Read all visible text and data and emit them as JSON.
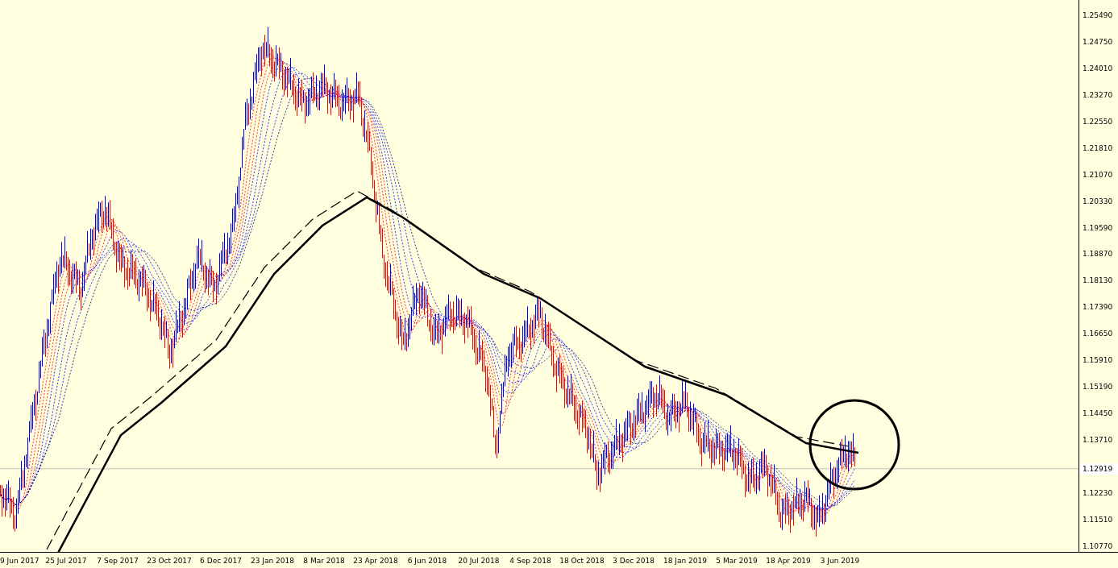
{
  "price_axis": {
    "labels": [
      "1.25490",
      "1.24750",
      "1.24010",
      "1.23270",
      "1.22550",
      "1.21810",
      "1.21070",
      "1.20330",
      "1.19590",
      "1.18870",
      "1.18130",
      "1.17390",
      "1.16650",
      "1.15910",
      "1.15190",
      "1.14450",
      "1.13710",
      "1.12230",
      "1.11510",
      "1.10770"
    ],
    "current_price": "1.12919"
  },
  "time_axis": {
    "labels": [
      "9 Jun 2017",
      "25 Jul 2017",
      "7 Sep 2017",
      "23 Oct 2017",
      "6 Dec 2017",
      "23 Jan 2018",
      "8 Mar 2018",
      "23 Apr 2018",
      "6 Jun 2018",
      "20 Jul 2018",
      "4 Sep 2018",
      "18 Oct 2018",
      "3 Dec 2018",
      "18 Jan 2019",
      "5 Mar 2019",
      "18 Apr 2019",
      "3 Jun 2019"
    ]
  }
}
